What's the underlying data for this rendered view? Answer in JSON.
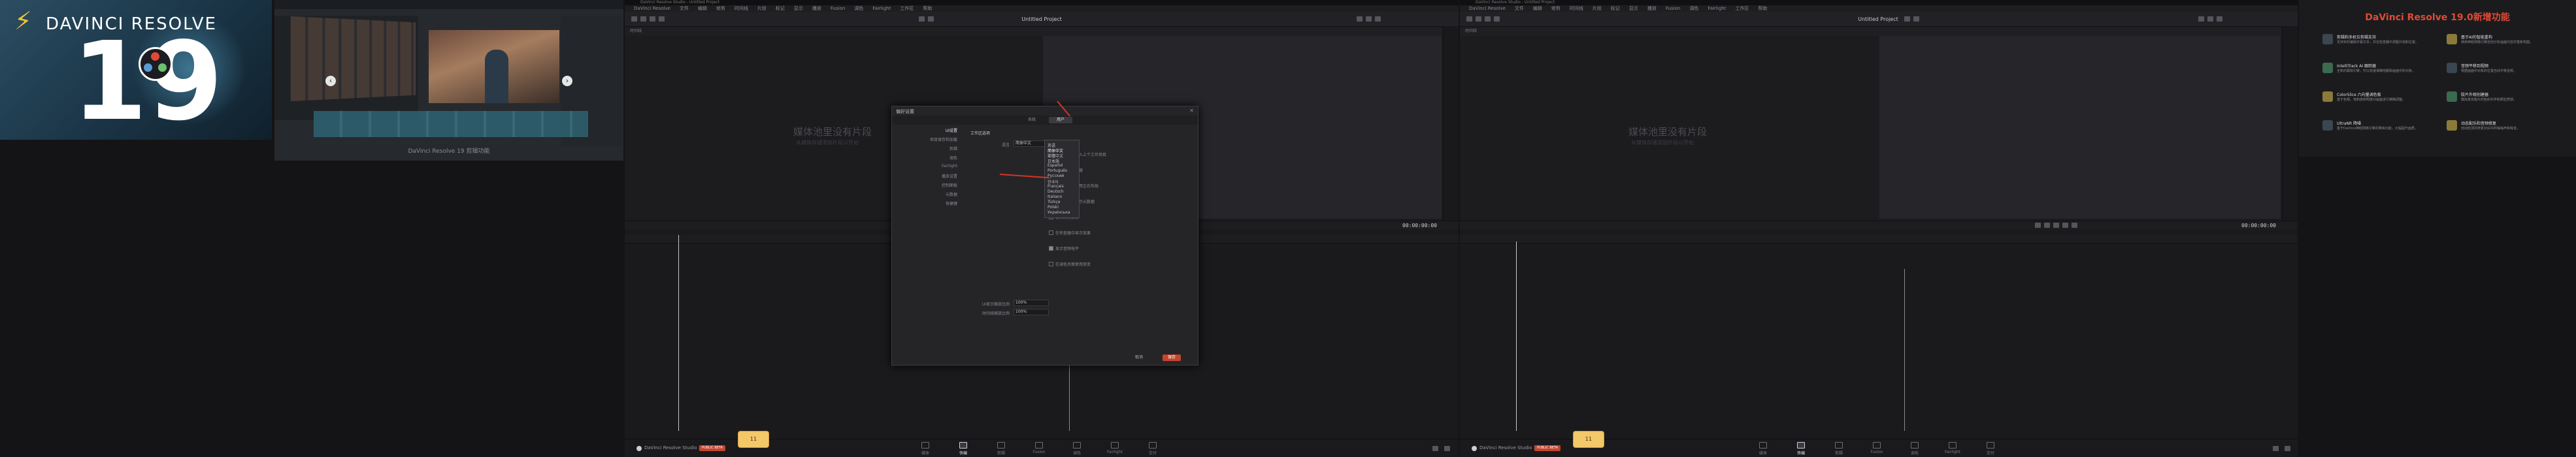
{
  "promo_hero": {
    "brand": "DAVINCI RESOLVE",
    "version": "19"
  },
  "promo_shot": {
    "caption": "DaVinci Resolve 19 剪辑功能",
    "prev": "‹",
    "next": "›"
  },
  "window_left": {
    "title": "DaVinci Resolve Studio - Untitled Project",
    "menu": [
      "DaVinci Resolve",
      "文件",
      "编辑",
      "修剪",
      "时间线",
      "片段",
      "标记",
      "显示",
      "播放",
      "Fusion",
      "调色",
      "Fairlight",
      "工作区",
      "帮助"
    ],
    "project_title": "Untitled Project",
    "viewer_label": "时间线",
    "timecode": "00:00:00:00",
    "empty_title": "媒体池里没有片段",
    "empty_sub": "从媒体存储添加片段以开始",
    "product": "DaVinci Resolve Studio 19",
    "badge": "PUBLIC BETA",
    "chip": "11"
  },
  "window_right": {
    "title": "DaVinci Resolve Studio - Untitled Project",
    "menu": [
      "DaVinci Resolve",
      "文件",
      "编辑",
      "修剪",
      "时间线",
      "片段",
      "标记",
      "显示",
      "播放",
      "Fusion",
      "调色",
      "Fairlight",
      "工作区",
      "帮助"
    ],
    "project_title": "Untitled Project",
    "viewer_label": "时间线",
    "timecode": "00:00:00:00",
    "empty_title": "媒体池里没有片段",
    "empty_sub": "从媒体存储添加片段以开始",
    "product": "DaVinci Resolve Studio 19",
    "badge": "PUBLIC BETA",
    "chip": "11"
  },
  "pages": [
    "媒体",
    "快编",
    "剪辑",
    "Fusion",
    "调色",
    "Fairlight",
    "交付"
  ],
  "dialog": {
    "title": "偏好设置",
    "tabs": [
      "系统",
      "用户"
    ],
    "active_tab": "用户",
    "sidebar": [
      "UI设置",
      "项目保存和加载",
      "剪辑",
      "调色",
      "Fairlight",
      "播放设置",
      "控制面板",
      "元数据",
      "快捷键"
    ],
    "section": "工作区选项",
    "language_label": "语言",
    "language_value": "简体中文",
    "options": [
      "启动时重新载入上个工作项目",
      "显示焦点指示器",
      "在媒体页面使用左右布局",
      "在剪辑页面显示元数据",
      "使用灰色背景",
      "在检查器中显示效果",
      "显示音频电平",
      "在调色页面使用渐变"
    ],
    "bottom_labels": [
      "UI显示缩放比例",
      "时间线缩放比例"
    ],
    "bottom_values": [
      "100%",
      "100%"
    ],
    "cancel": "取消",
    "save": "保存"
  },
  "language_dropdown": [
    "英语",
    "简体中文",
    "繁體中文",
    "日本語",
    "Español",
    "Português",
    "Русский",
    "한국어",
    "Français",
    "Deutsch",
    "Italiano",
    "Türkçe",
    "Polski",
    "Українська"
  ],
  "language_selected": "简体中文",
  "promo_features": {
    "title": "DaVinci Resolve 19.0新增功能",
    "items": [
      {
        "title": "剪辑和多机位剪辑支持",
        "desc": "支持实时编辑字幕文本，并在检查器中调整外观和位置。"
      },
      {
        "title": "基于AI的智能重构",
        "desc": "使用神经网络引擎自动分析画面内容并重新构图。"
      },
      {
        "title": "IntelliTrack AI 跟踪器",
        "desc": "全新的跟踪引擎，可以快速准确地跟踪画面中的对象。"
      },
      {
        "title": "音频平移到视频",
        "desc": "根据画面中对象的位置自动平移音频。"
      },
      {
        "title": "ColorSlice 六向量调色板",
        "desc": "基于色相、饱和度和明度对画面进行精确调整。"
      },
      {
        "title": "胶片外观创建器",
        "desc": "模拟真实胶片的色彩科学和颗粒质感。"
      },
      {
        "title": "UltraNR 降噪",
        "desc": "基于DaVinci神经网络引擎的降噪功能，大幅提升画质。"
      },
      {
        "title": "动态配乐和音频修复",
        "desc": "自动检测并修复对白中的嗡嗡声和噪音。"
      }
    ]
  },
  "colors": {
    "accent": "#c4452e",
    "arrow": "#d2352a",
    "brand_yellow": "#f2c230",
    "logo_red": "#e04a35"
  },
  "icons": [
    "bolt-icon",
    "resolve-logo-icon",
    "close-icon",
    "media-page-icon",
    "cut-page-icon",
    "edit-page-icon",
    "fusion-page-icon",
    "color-page-icon",
    "fairlight-page-icon",
    "deliver-page-icon",
    "home-icon",
    "settings-icon"
  ]
}
